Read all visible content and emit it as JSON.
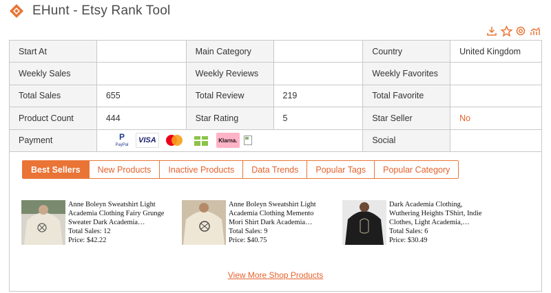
{
  "header": {
    "title": "EHunt - Etsy Rank Tool",
    "logo_icon": "ehunt-logo-icon",
    "accent": "#e97436"
  },
  "toolbar": {
    "icons": [
      "download-icon",
      "star-icon",
      "settings-icon",
      "chart-icon"
    ]
  },
  "stats": {
    "start_at": {
      "label": "Start At",
      "value": ""
    },
    "main_category": {
      "label": "Main Category",
      "value": ""
    },
    "country": {
      "label": "Country",
      "value": "United Kingdom"
    },
    "weekly_sales": {
      "label": "Weekly Sales",
      "value": ""
    },
    "weekly_reviews": {
      "label": "Weekly Reviews",
      "value": ""
    },
    "weekly_favorites": {
      "label": "Weekly Favorites",
      "value": ""
    },
    "total_sales": {
      "label": "Total Sales",
      "value": "655"
    },
    "total_review": {
      "label": "Total Review",
      "value": "219"
    },
    "total_favorite": {
      "label": "Total Favorite",
      "value": ""
    },
    "product_count": {
      "label": "Product Count",
      "value": "444"
    },
    "star_rating": {
      "label": "Star Rating",
      "value": "5"
    },
    "star_seller": {
      "label": "Star Seller",
      "value": "No",
      "color": "#e5622c"
    },
    "payment": {
      "label": "Payment",
      "logos": [
        "paypal-icon",
        "visa-icon",
        "mastercard-icon",
        "giftcard-icon",
        "klarna-icon",
        "broken-image-icon"
      ]
    },
    "social": {
      "label": "Social",
      "value": ""
    }
  },
  "payment_logos": {
    "paypal_text": "PayPal",
    "visa_text": "VISA",
    "klarna_text": "Klarna."
  },
  "tabs": [
    {
      "label": "Best Sellers",
      "active": true
    },
    {
      "label": "New Products",
      "active": false
    },
    {
      "label": "Inactive Products",
      "active": false
    },
    {
      "label": "Data Trends",
      "active": false
    },
    {
      "label": "Popular Tags",
      "active": false
    },
    {
      "label": "Popular Category",
      "active": false
    }
  ],
  "products": [
    {
      "name": "Anne Boleyn Sweatshirt Light Academia Clothing Fairy Grunge Sweater Dark Academia Gothic…",
      "sales": "Total Sales: 12",
      "price": "Price: $42.22"
    },
    {
      "name": "Anne Boleyn Sweatshirt Light Academia Clothing Memento Mori Shirt Dark Academia Gothic Clothes…",
      "sales": "Total Sales: 9",
      "price": "Price: $40.75"
    },
    {
      "name": "Dark Academia Clothing, Wuthering Heights TShirt, Indie Clothes, Light Academia, Aesthetic Clothes,…",
      "sales": "Total Sales: 6",
      "price": "Price: $30.49"
    }
  ],
  "view_more": "View More Shop Products"
}
